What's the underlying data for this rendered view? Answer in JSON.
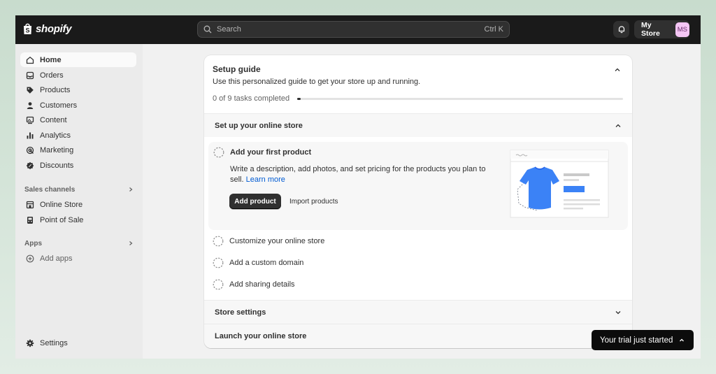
{
  "topbar": {
    "brand": "shopify",
    "search": {
      "placeholder": "Search",
      "shortcut": "Ctrl K"
    },
    "store_name": "My Store",
    "avatar_initials": "MS"
  },
  "sidebar": {
    "items": [
      {
        "label": "Home",
        "icon": "home-icon",
        "active": true
      },
      {
        "label": "Orders",
        "icon": "inbox-icon"
      },
      {
        "label": "Products",
        "icon": "tag-icon"
      },
      {
        "label": "Customers",
        "icon": "person-icon"
      },
      {
        "label": "Content",
        "icon": "image-icon"
      },
      {
        "label": "Analytics",
        "icon": "bar-chart-icon"
      },
      {
        "label": "Marketing",
        "icon": "target-icon"
      },
      {
        "label": "Discounts",
        "icon": "discount-icon"
      }
    ],
    "sales_channels": {
      "title": "Sales channels",
      "items": [
        {
          "label": "Online Store",
          "icon": "storefront-icon"
        },
        {
          "label": "Point of Sale",
          "icon": "pos-icon"
        }
      ]
    },
    "apps": {
      "title": "Apps",
      "items": [
        {
          "label": "Add apps",
          "icon": "plus-circle-icon"
        }
      ]
    },
    "settings_label": "Settings"
  },
  "setup_guide": {
    "title": "Setup guide",
    "subtitle": "Use this personalized guide to get your store up and running.",
    "progress_label": "0 of 9 tasks completed",
    "progress_completed": 0,
    "progress_total": 9,
    "section_online_store": "Set up your online store",
    "expanded_task": {
      "title": "Add your first product",
      "description": "Write a description, add photos, and set pricing for the products you plan to sell.",
      "link": "Learn more",
      "primary_button": "Add product",
      "secondary_button": "Import products"
    },
    "tasks": [
      "Customize your online store",
      "Add a custom domain",
      "Add sharing details"
    ],
    "section_store_settings": "Store settings",
    "section_launch": "Launch your online store"
  },
  "toast": {
    "text": "Your trial just started"
  },
  "colors": {
    "topbar": "#1a1a1a",
    "link": "#005bd3",
    "tshirt": "#3b82f6"
  }
}
